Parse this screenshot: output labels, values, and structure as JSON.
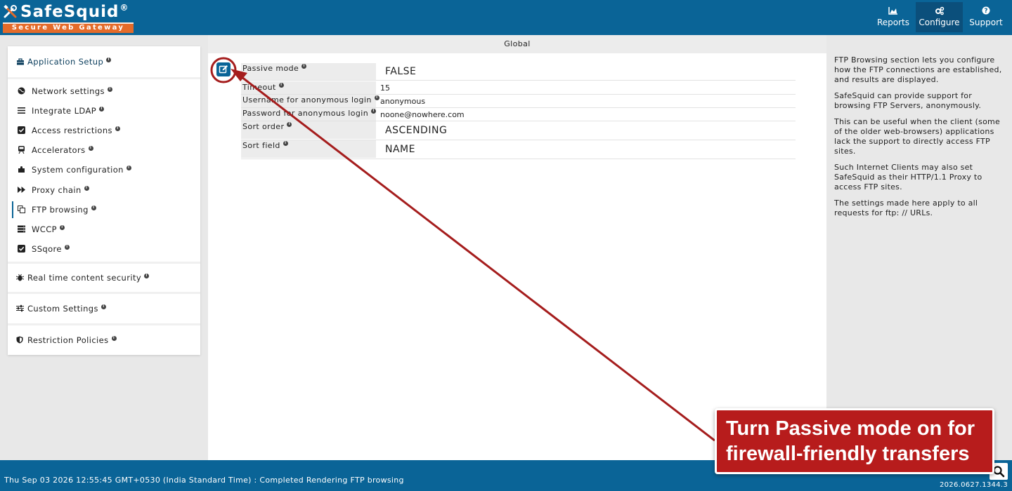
{
  "brand": {
    "name": "SafeSquid",
    "registered": "®",
    "tagline": "Secure Web Gateway"
  },
  "header_nav": [
    {
      "label": "Reports",
      "icon": "area-chart-icon",
      "active": false
    },
    {
      "label": "Configure",
      "icon": "gears-icon",
      "active": true
    },
    {
      "label": "Support",
      "icon": "question-circle-icon",
      "active": false
    }
  ],
  "sidebar": {
    "groups": [
      {
        "label": "Application Setup",
        "icon": "briefcase-icon"
      },
      {
        "label": "Real time content security",
        "icon": "bug-icon"
      },
      {
        "label": "Custom Settings",
        "icon": "sliders-icon"
      },
      {
        "label": "Restriction Policies",
        "icon": "shield-icon"
      }
    ],
    "items": [
      {
        "label": "Network settings",
        "icon": "globe-icon"
      },
      {
        "label": "Integrate LDAP",
        "icon": "list-icon"
      },
      {
        "label": "Access restrictions",
        "icon": "check-square-icon"
      },
      {
        "label": "Accelerators",
        "icon": "train-icon"
      },
      {
        "label": "System configuration",
        "icon": "puzzle-icon"
      },
      {
        "label": "Proxy chain",
        "icon": "fast-forward-icon"
      },
      {
        "label": "FTP browsing",
        "icon": "copy-icon",
        "active": true
      },
      {
        "label": "WCCP",
        "icon": "server-icon"
      },
      {
        "label": "SSqore",
        "icon": "check-square-icon"
      }
    ]
  },
  "main": {
    "title": "Global",
    "fields": [
      {
        "key": "Passive mode",
        "value": "FALSE"
      },
      {
        "key": "Timeout",
        "value": "15"
      },
      {
        "key": "Username for anonymous login",
        "value": "anonymous"
      },
      {
        "key": "Password for anonymous login",
        "value": "noone@nowhere.com"
      },
      {
        "key": "Sort order",
        "value": "ASCENDING"
      },
      {
        "key": "Sort field",
        "value": "NAME"
      }
    ]
  },
  "help": {
    "paragraphs": [
      "FTP Browsing section lets you configure how the FTP connections are established, and results are displayed.",
      "SafeSquid can provide support for browsing FTP Servers, anonymously.",
      "This can be useful when the client (some of the older web-browsers) applications lack the support to directly access FTP sites.",
      "Such Internet Clients may also set SafeSquid as their HTTP/1.1 Proxy to access FTP sites.",
      "The settings made here apply to all requests for ftp: // URLs."
    ]
  },
  "footer": {
    "status": "Thu Sep 03 2026 12:55:45 GMT+0530 (India Standard Time) : Completed Rendering FTP browsing",
    "version": "2026.0627.1344.3"
  },
  "annotation": {
    "callout_line1": "Turn Passive mode on for",
    "callout_line2": "firewall-friendly transfers",
    "color": "#b71c1c"
  },
  "colors": {
    "header": "#0a6497",
    "header_active": "#0b4f7b",
    "brand_orange": "#e46b2a"
  }
}
